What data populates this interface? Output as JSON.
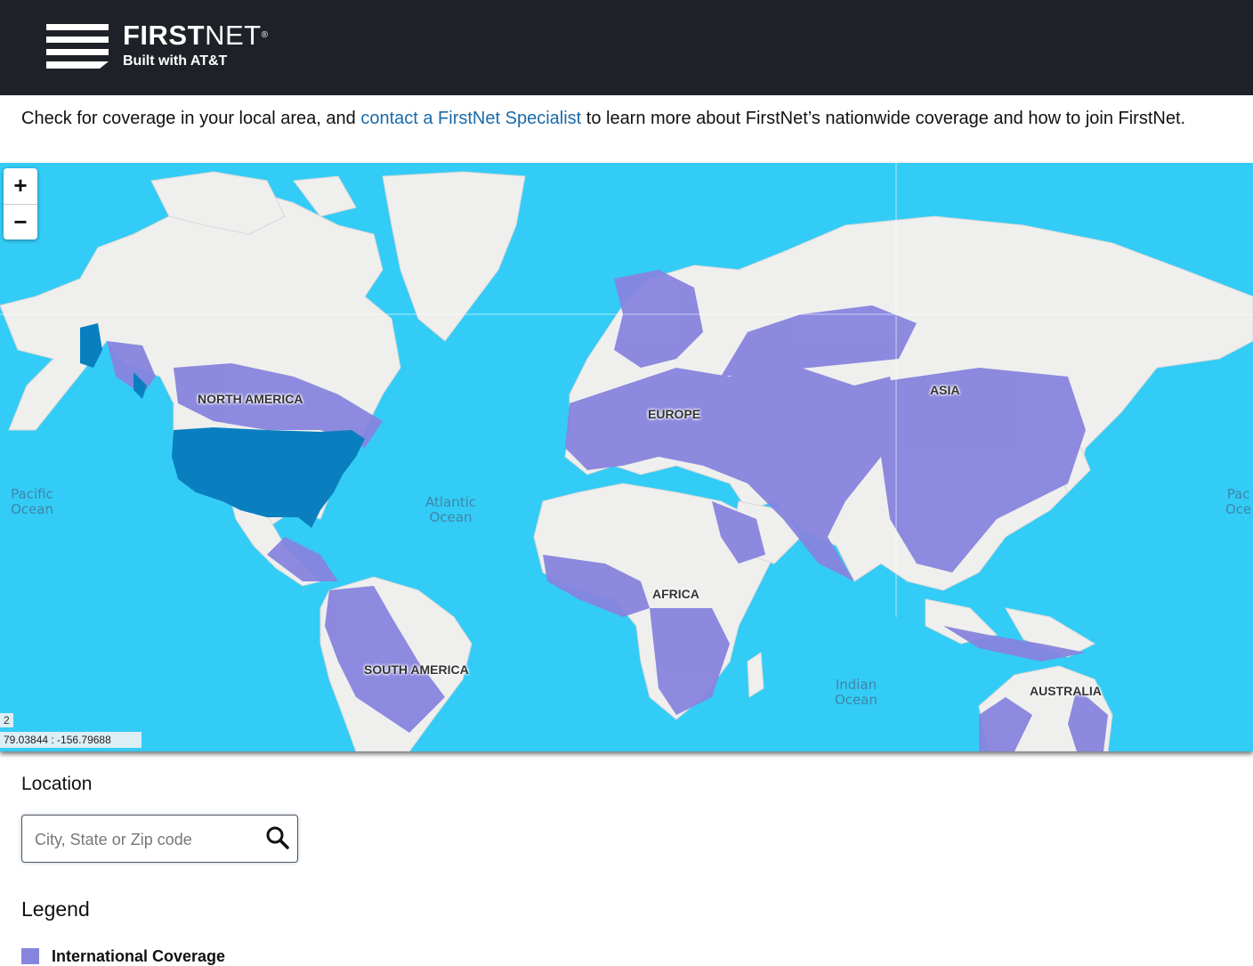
{
  "header": {
    "brand_bold": "FIRST",
    "brand_thin": "NET",
    "brand_mark": "®",
    "subtitle": "Built with AT&T"
  },
  "intro": {
    "before": "Check for coverage in your local area, and ",
    "link": "contact a FirstNet Specialist",
    "after": " to learn more about FirstNet’s nationwide coverage and how to join FirstNet."
  },
  "map": {
    "zoom_in": "+",
    "zoom_out": "−",
    "zoom_level": "2",
    "coordinates": "79.03844 : -156.79688",
    "continents": {
      "north_america": "NORTH AMERICA",
      "europe": "EUROPE",
      "asia": "ASIA",
      "africa": "AFRICA",
      "south_america": "SOUTH AMERICA",
      "australia": "AUSTRALIA"
    },
    "oceans": {
      "pacific_left_1": "Pacific",
      "pacific_left_2": "Ocean",
      "atlantic_1": "Atlantic",
      "atlantic_2": "Ocean",
      "indian_1": "Indian",
      "indian_2": "Ocean",
      "pacific_right_1": "Pac",
      "pacific_right_2": "Oce"
    },
    "colors": {
      "ocean": "#33ccf6",
      "land": "#efefee",
      "international_coverage": "#8784de",
      "us_coverage": "#0a7fc0"
    }
  },
  "location": {
    "title": "Location",
    "placeholder": "City, State or Zip code",
    "value": ""
  },
  "legend": {
    "title": "Legend",
    "items": [
      {
        "label": "International Coverage",
        "color": "#8784de"
      }
    ]
  }
}
